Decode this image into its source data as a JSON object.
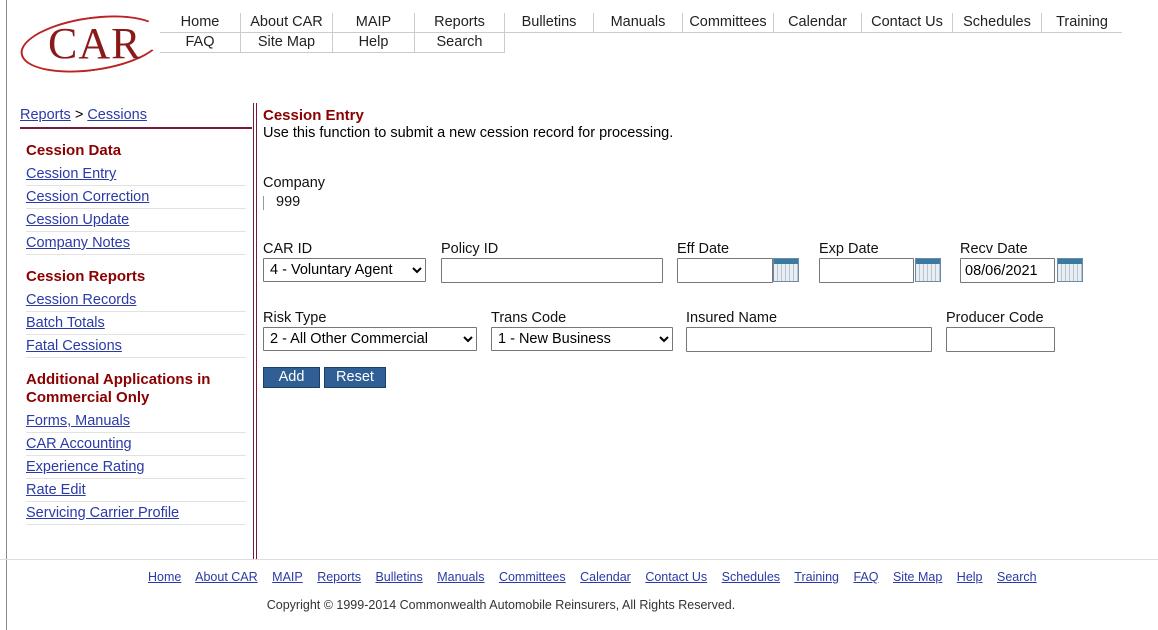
{
  "brand": {
    "logo_text": "CAR"
  },
  "topnav": {
    "row1": [
      "Home",
      "About CAR",
      "MAIP",
      "Reports",
      "Bulletins",
      "Manuals",
      "Committees",
      "Calendar",
      "Contact Us",
      "Schedules",
      "Training"
    ],
    "row2": [
      "FAQ",
      "Site Map",
      "Help",
      "Search"
    ]
  },
  "breadcrumb": {
    "part1": "Reports",
    "sep": ">",
    "part2": "Cessions"
  },
  "sidebar": {
    "sec1_title": "Cession Data",
    "sec1_items": [
      "Cession Entry",
      "Cession Correction",
      "Cession Update",
      "Company Notes"
    ],
    "sec2_title": "Cession Reports",
    "sec2_items": [
      "Cession Records",
      "Batch Totals",
      "Fatal Cessions"
    ],
    "sec3_title": "Additional Applications in Commercial Only",
    "sec3_items": [
      "Forms, Manuals",
      "CAR Accounting",
      "Experience Rating",
      "Rate Edit",
      "Servicing Carrier Profile"
    ]
  },
  "main": {
    "title": "Cession Entry",
    "description": "Use this function to submit a new cession record for processing.",
    "company_label": "Company",
    "company_value": "999",
    "car_id_label": "CAR ID",
    "car_id_value": "4 - Voluntary Agent",
    "policy_id_label": "Policy ID",
    "policy_id_value": "",
    "eff_date_label": "Eff Date",
    "eff_date_value": "",
    "exp_date_label": "Exp Date",
    "exp_date_value": "",
    "recv_date_label": "Recv Date",
    "recv_date_value": "08/06/2021",
    "risk_type_label": "Risk Type",
    "risk_type_value": "2 - All Other Commercial",
    "trans_code_label": "Trans Code",
    "trans_code_value": "1 - New Business",
    "insured_name_label": "Insured Name",
    "insured_name_value": "",
    "producer_code_label": "Producer Code",
    "producer_code_value": "",
    "add_label": "Add",
    "reset_label": "Reset"
  },
  "footer": {
    "links": [
      "Home",
      "About CAR",
      "MAIP",
      "Reports",
      "Bulletins",
      "Manuals",
      "Committees",
      "Calendar",
      "Contact Us",
      "Schedules",
      "Training",
      "FAQ",
      "Site Map",
      "Help",
      "Search"
    ],
    "copyright": "Copyright © 1999-2014 Commonwealth Automobile Reinsurers, All Rights Reserved."
  },
  "colors": {
    "heading": "#8b0000",
    "link": "#2a3aa8",
    "button": "#2f5f94",
    "divider": "#7a1a3a"
  }
}
